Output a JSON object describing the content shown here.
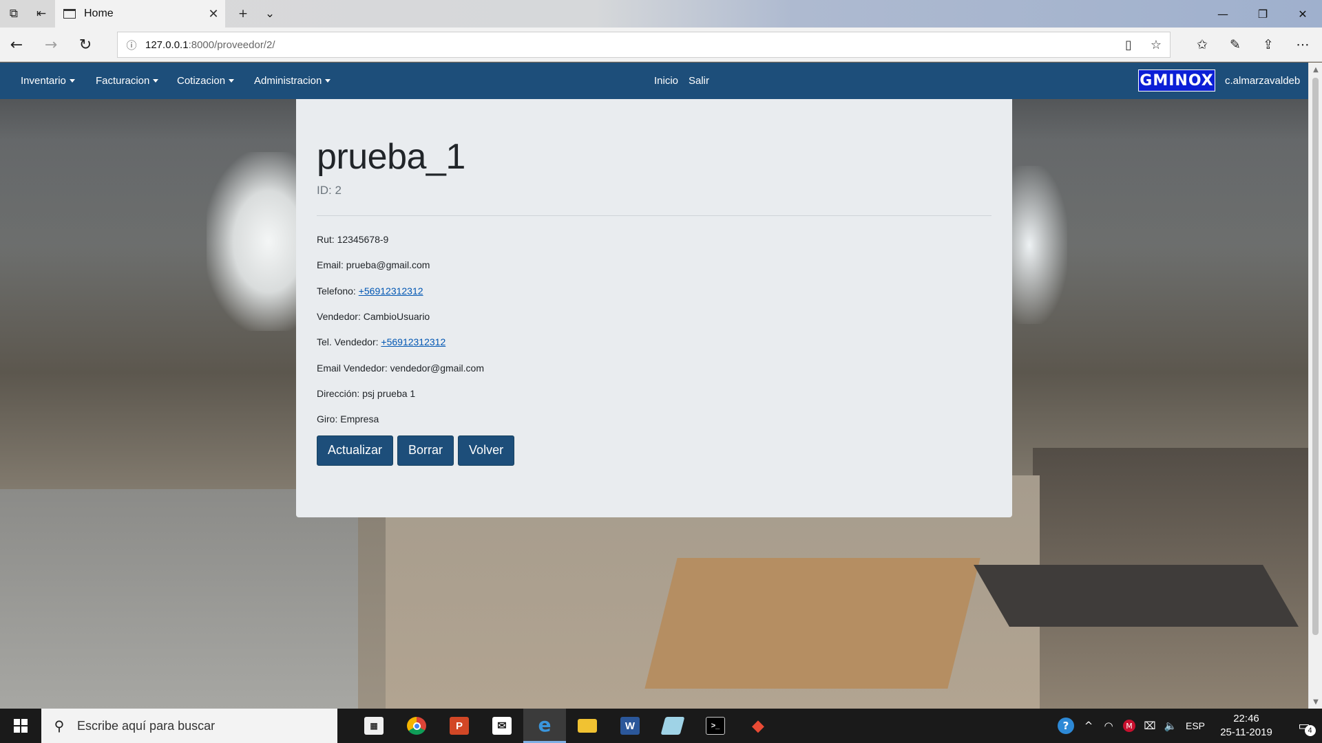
{
  "browser": {
    "tab_title": "Home",
    "url_host": "127.0.0.1",
    "url_path": ":8000/proveedor/2/"
  },
  "navbar": {
    "menus": [
      "Inventario",
      "Facturacion",
      "Cotizacion",
      "Administracion"
    ],
    "links": [
      "Inicio",
      "Salir"
    ],
    "logo_text": "GMINOX",
    "username": "c.almarzavaldeb"
  },
  "provider": {
    "name": "prueba_1",
    "id_text": "ID: 2",
    "fields": {
      "rut_label": "Rut: ",
      "rut": "12345678-9",
      "email_label": "Email: ",
      "email": "prueba@gmail.com",
      "telefono_label": "Telefono: ",
      "telefono": "+56912312312",
      "vendedor_label": "Vendedor: ",
      "vendedor": "CambioUsuario",
      "tel_vendedor_label": "Tel. Vendedor: ",
      "tel_vendedor": "+56912312312",
      "email_vendedor_label": "Email Vendedor: ",
      "email_vendedor": "vendedor@gmail.com",
      "direccion_label": "Dirección: ",
      "direccion": "psj prueba 1",
      "giro_label": "Giro: ",
      "giro": "Empresa"
    },
    "buttons": {
      "update": "Actualizar",
      "delete": "Borrar",
      "back": "Volver"
    }
  },
  "taskbar": {
    "search_placeholder": "Escribe aquí para buscar",
    "language": "ESP",
    "time": "22:46",
    "date": "25-11-2019",
    "notification_count": "4"
  },
  "colors": {
    "navbar": "#1d4e7a",
    "card": "#e9ecef",
    "button": "#1d4e7a",
    "logo": "#0b1fd6",
    "link": "#0056b3"
  }
}
